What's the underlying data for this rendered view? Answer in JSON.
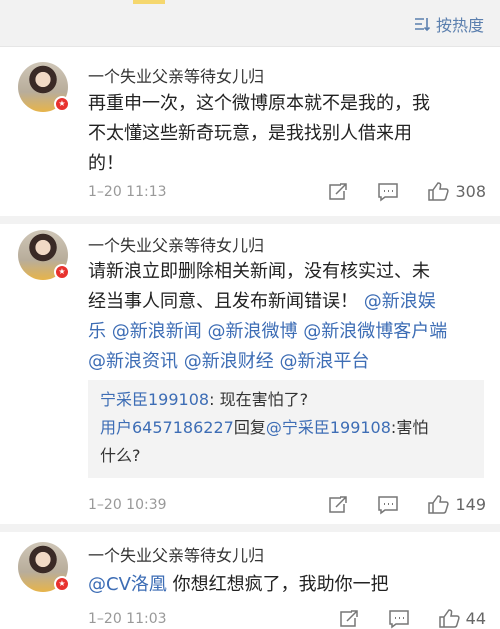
{
  "sort": {
    "label": "按热度"
  },
  "comments": [
    {
      "username": "一个失业父亲等待女儿归",
      "lines": [
        "再重申一次，这个微博原本就不是我的，我",
        "不太懂这些新奇玩意，是我找别人借来用",
        "的！"
      ],
      "time": "1–20 11:13",
      "likes": "308"
    },
    {
      "username": "一个失业父亲等待女儿归",
      "line1": "请新浪立即删除相关新闻，没有核实过、未",
      "line2_a": "经当事人同意、且发布新闻错误！",
      "line2_b": "@新浪娱",
      "line3_a": "乐",
      "line3_b": "@新浪新闻",
      "line3_c": "@新浪微博",
      "line3_d": "@新浪微博客户端",
      "line4_a": "@新浪资讯",
      "line4_b": "@新浪财经",
      "line4_c": "@新浪平台",
      "replies": [
        {
          "who": "宁采臣199108",
          "sep": ": ",
          "text": "现在害怕了?"
        },
        {
          "who": "用户6457186227",
          "mid": "回复",
          "who2": "@宁采臣199108",
          "sep": ":",
          "text": "害怕",
          "text2": "什么?"
        }
      ],
      "time": "1–20 10:39",
      "likes": "149"
    },
    {
      "username": "一个失业父亲等待女儿归",
      "mention": "@CV洛凰",
      "text": " 你想红想疯了，我助你一把",
      "time": "1–20 11:03",
      "likes": "44"
    }
  ],
  "colors": {
    "link": "#3d6db5",
    "sort": "#5b7fae",
    "badge": "#e8322e",
    "separator": "#f2f2f2"
  }
}
